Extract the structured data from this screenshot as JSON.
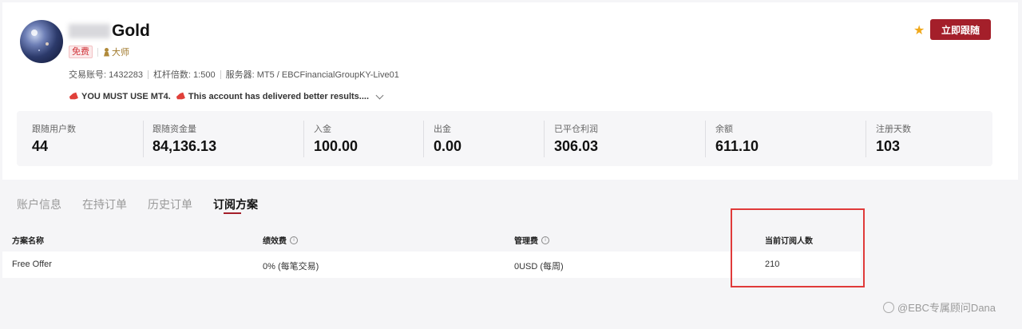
{
  "profile": {
    "name_visible": "Gold",
    "tag_free": "免费",
    "tag_master": "大师",
    "account_label": "交易账号: 1432283",
    "leverage_label": "杠杆倍数: 1:500",
    "server_label": "服务器: MT5 / EBCFinancialGroupKY-Live01",
    "notice_part1": "YOU MUST USE MT4.",
    "notice_part2": "This account has delivered better results...."
  },
  "actions": {
    "follow_label": "立即跟随",
    "favorite_icon": "star-icon"
  },
  "stats": [
    {
      "label": "跟随用户数",
      "value": "44"
    },
    {
      "label": "跟随资金量",
      "value": "84,136.13"
    },
    {
      "label": "入金",
      "value": "100.00"
    },
    {
      "label": "出金",
      "value": "0.00"
    },
    {
      "label": "已平仓利润",
      "value": "306.03"
    },
    {
      "label": "余额",
      "value": "611.10"
    },
    {
      "label": "注册天数",
      "value": "103"
    }
  ],
  "tabs": [
    {
      "label": "账户信息",
      "active": false
    },
    {
      "label": "在持订单",
      "active": false
    },
    {
      "label": "历史订单",
      "active": false
    },
    {
      "label": "订阅方案",
      "active": true
    }
  ],
  "plan_table": {
    "headers": [
      "方案名称",
      "绩效费",
      "管理费",
      "当前订阅人数"
    ],
    "rows": [
      {
        "name": "Free Offer",
        "performance_fee": "0% (每笔交易)",
        "management_fee": "0USD (每周)",
        "subscribers": "210"
      }
    ]
  },
  "colors": {
    "accent": "#a41f2a",
    "highlight_border": "#e03a3a",
    "star": "#f0a81a"
  },
  "watermark": "@EBC专属顾问Dana"
}
